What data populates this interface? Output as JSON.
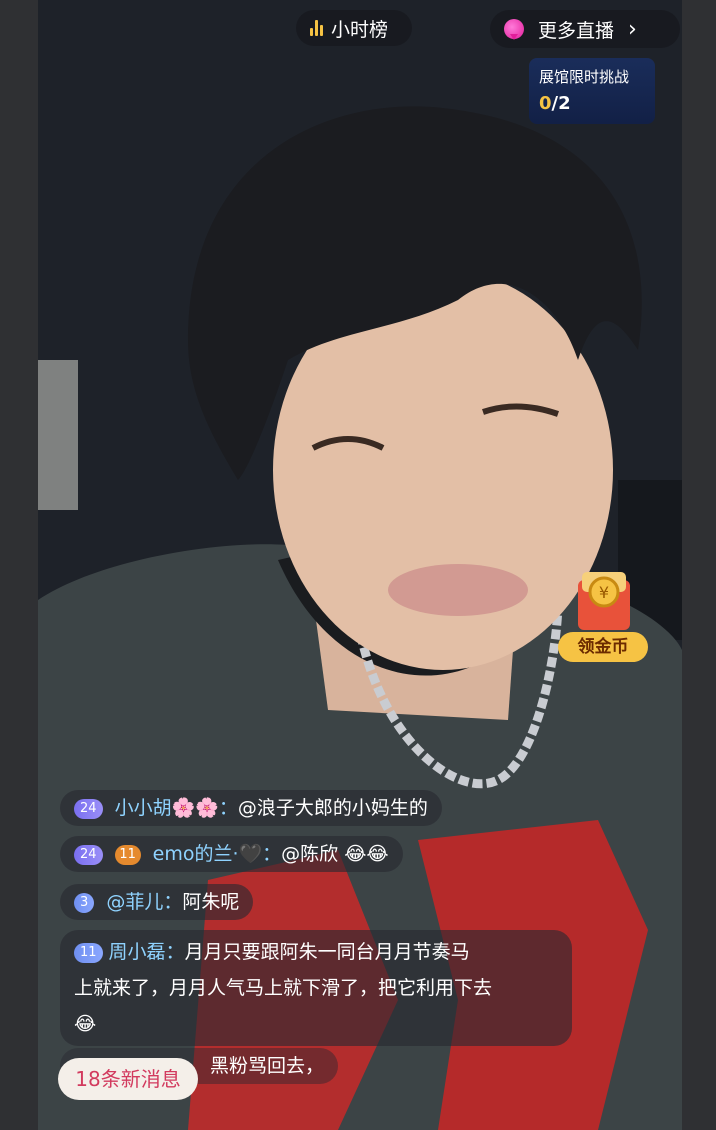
{
  "top": {
    "hour_rank": "小时榜",
    "more_live": "更多直播",
    "challenge_title": "展馆限时挑战",
    "challenge_current": "0",
    "challenge_total": "/2"
  },
  "coin": {
    "label": "领金币"
  },
  "comments": [
    {
      "level": "24",
      "user": "小小胡🌸🌸：",
      "text": "@浪子大郎的小妈生的"
    },
    {
      "level": "24",
      "badge2": "11",
      "user": "emo的兰·🖤：",
      "text": "@陈欣",
      "emoji": "😂😂"
    },
    {
      "level": "3",
      "user": "@菲儿：",
      "text": "阿朱呢"
    },
    {
      "level": "11",
      "user": "周小磊：",
      "text": "月月只要跟阿朱一同台月月节奏马",
      "line2": "上就来了，月月人气马上就下滑了，把它利用下去",
      "emoji": "😂"
    },
    {
      "text": "黑粉骂回去，"
    }
  ],
  "new_messages": "18条新消息",
  "colors": {
    "accent": "#f6c344",
    "username": "#8fd3ff",
    "new_msg_text": "#d23a5e"
  }
}
